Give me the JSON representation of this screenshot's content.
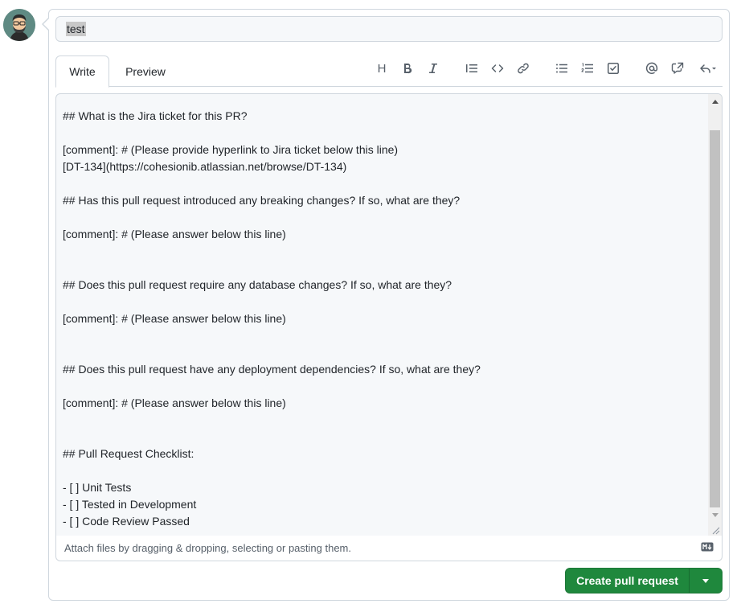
{
  "title_input": {
    "value": "test"
  },
  "tabs": [
    {
      "label": "Write",
      "active": true
    },
    {
      "label": "Preview",
      "active": false
    }
  ],
  "toolbar": {
    "heading_glyph": "H",
    "icons": [
      "heading-icon",
      "bold-icon",
      "italic-icon",
      "quote-icon",
      "code-icon",
      "link-icon",
      "unordered-list-icon",
      "ordered-list-icon",
      "task-list-icon",
      "mention-icon",
      "cross-reference-icon",
      "reply-icon"
    ]
  },
  "editor": {
    "lines": [
      "## What is the Jira ticket for this PR?",
      "",
      "[comment]: # (Please provide hyperlink to Jira ticket below this line)",
      "[DT-134](https://cohesionib.atlassian.net/browse/DT-134)",
      "",
      "## Has this pull request introduced any breaking changes? If so, what are they?",
      "",
      "[comment]: # (Please answer below this line)",
      "",
      "",
      "## Does this pull request require any database changes? If so, what are they?",
      "",
      "[comment]: # (Please answer below this line)",
      "",
      "",
      "## Does this pull request have any deployment dependencies? If so, what are they?",
      "",
      "[comment]: # (Please answer below this line)",
      "",
      "",
      "## Pull Request Checklist:",
      "",
      "- [ ] Unit Tests",
      "- [ ] Tested in Development",
      "- [ ] Code Review Passed"
    ]
  },
  "footer": {
    "attach_text": "Attach files by dragging & dropping, selecting or pasting them."
  },
  "actions": {
    "create_label": "Create pull request"
  },
  "colors": {
    "primary": "#1f883d",
    "border": "#d0d7de",
    "muted": "#57606a",
    "editor_bg": "#f6f8fa"
  }
}
